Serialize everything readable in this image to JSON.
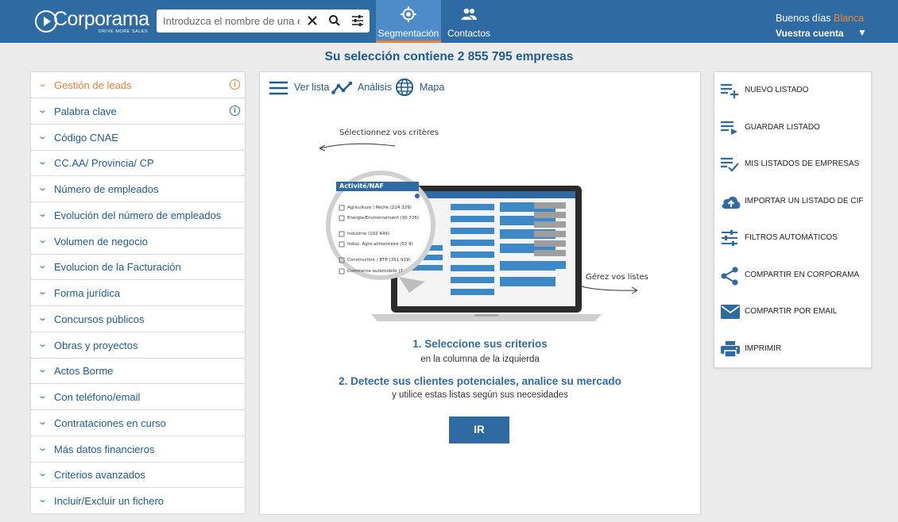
{
  "header": {
    "logo_text": "Corporama",
    "logo_tagline": "DRIVE MORE SALES",
    "search_placeholder": "Introduzca el nombre de una empresa",
    "tabs": [
      {
        "label": "Segmentación",
        "icon": "target-icon",
        "active": true
      },
      {
        "label": "Contactos",
        "icon": "people-icon",
        "active": false
      }
    ],
    "greeting": "Buenos días",
    "user_name": "Blanca",
    "account_label": "Vuestra cuenta",
    "account_caret": "▼"
  },
  "selection_title": "Su selección contiene 2 855 795 empresas",
  "criteria": [
    {
      "label": "Gestión de leads",
      "active": true,
      "info": true
    },
    {
      "label": "Palabra clave",
      "active": false,
      "info": true
    },
    {
      "label": "Código CNAE"
    },
    {
      "label": "CC.AA/ Provincia/ CP"
    },
    {
      "label": "Número de empleados"
    },
    {
      "label": "Evolución del número de empleados"
    },
    {
      "label": "Volumen de negocio"
    },
    {
      "label": "Evolucion de la Facturación"
    },
    {
      "label": "Forma jurídica"
    },
    {
      "label": "Concursos públicos"
    },
    {
      "label": "Obras y proyectos"
    },
    {
      "label": "Actos Borme"
    },
    {
      "label": "Con teléfono/email"
    },
    {
      "label": "Contrataciones en curso"
    },
    {
      "label": "Más datos financieros"
    },
    {
      "label": "Criterios avanzados"
    },
    {
      "label": "Incluir/Excluir un fichero"
    }
  ],
  "views": [
    {
      "label": "Ver lista",
      "icon": "list-icon"
    },
    {
      "label": "Análisis",
      "icon": "analysis-icon"
    },
    {
      "label": "Mapa",
      "icon": "globe-icon"
    }
  ],
  "illustration": {
    "annotation_left": "Sélectionnez vos critères",
    "annotation_right": "Gérez vos listes",
    "panel_title": "Activité/NAF",
    "panel_rows": [
      "Agriculture / Pêche (224 329)",
      "Energie/Environnement (30 726)",
      "Industrie (102 449)",
      "Indus. Agro-alimentaire (52 9)",
      "Construction / BTP (351 919)",
      "Commerce automobile (7"
    ]
  },
  "steps": [
    {
      "title": "1. Seleccione sus criterios",
      "subtitle": "en la columna de la izquierda"
    },
    {
      "title": "2. Detecte sus clientes potenciales, analice su mercado",
      "subtitle": "y utilice estas listas según sus necesidades"
    }
  ],
  "go_button": "IR",
  "actions": [
    {
      "label": "NUEVO LISTADO",
      "icon": "playlist-add-icon"
    },
    {
      "label": "GUARDAR LISTADO",
      "icon": "playlist-save-icon"
    },
    {
      "label": "MIS LISTADOS DE EMPRESAS",
      "icon": "playlist-check-icon"
    },
    {
      "label": "IMPORTAR UN LISTADO DE CIF",
      "icon": "cloud-upload-icon"
    },
    {
      "label": "FILTROS AUTOMÁTICOS",
      "icon": "sliders-icon"
    },
    {
      "label": "COMPARTIR EN CORPORAMA",
      "icon": "share-icon"
    },
    {
      "label": "COMPARTIR POR EMAIL",
      "icon": "mail-icon"
    },
    {
      "label": "IMPRIMIR",
      "icon": "printer-icon"
    }
  ],
  "colors": {
    "brand": "#2e6ba3",
    "accent": "#e8823a",
    "text": "#1f5b8c"
  }
}
